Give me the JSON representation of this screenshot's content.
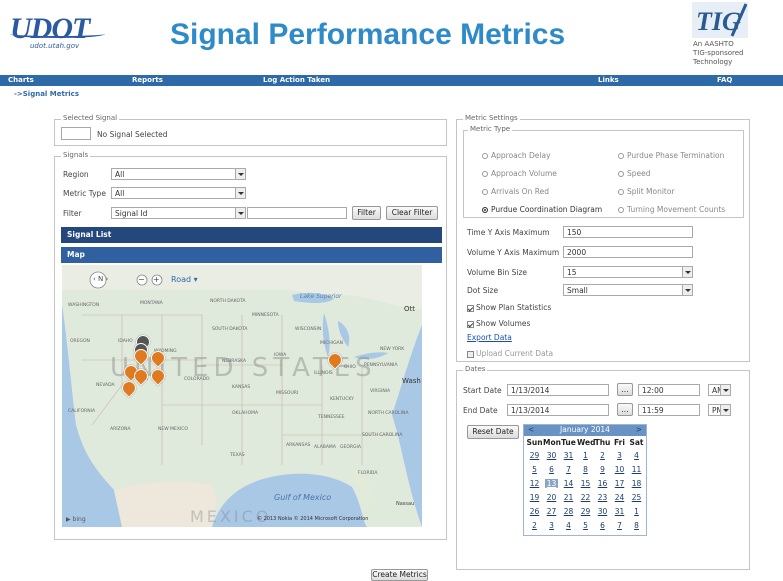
{
  "header": {
    "logo_text": "UDOT",
    "logo_url": "udot.utah.gov",
    "title": "Signal Performance Metrics",
    "tig_logo_text": "TIG",
    "tig_caption": [
      "An AASHTO",
      "TIG-sponsored",
      "Technology"
    ]
  },
  "nav": {
    "items": [
      "Charts",
      "Reports",
      "Log Action Taken",
      "Links",
      "FAQ"
    ]
  },
  "breadcrumb": "->Signal Metrics",
  "selected_signal": {
    "legend": "Selected Signal",
    "value": "",
    "text": "No Signal Selected"
  },
  "signals": {
    "legend": "Signals",
    "region_label": "Region",
    "region_value": "All",
    "metric_type_label": "Metric Type",
    "metric_type_value": "All",
    "filter_label": "Filter",
    "filter_field_value": "Signal Id",
    "filter_text": "",
    "filter_button": "Filter",
    "clear_filter_button": "Clear Filter",
    "signal_list_label": "Signal List",
    "map_label": "Map"
  },
  "map": {
    "road_label": "Road",
    "country_label": "UNITED STATES",
    "gulf_label": "Gulf of Mexico",
    "copyright": "© 2013 Nokia  © 2014 Microsoft Corporation",
    "bing": "bing",
    "labels": [
      "Lake Superior",
      "WASHINGTON",
      "MONTANA",
      "NORTH DAKOTA",
      "MINNESOTA",
      "OREGON",
      "IDAHO",
      "SOUTH DAKOTA",
      "WISCONSIN",
      "WYOMING",
      "NEBRASKA",
      "IOWA",
      "MICHIGAN",
      "NEW YORK",
      "NEVADA",
      "UTAH",
      "COLORADO",
      "KANSAS",
      "MISSOURI",
      "ILLINOIS",
      "OHIO",
      "PENNSYLVANIA",
      "CALIFORNIA",
      "ARIZONA",
      "NEW MEXICO",
      "OKLAHOMA",
      "TENNESSEE",
      "NORTH CAROLINA",
      "TEXAS",
      "ARKANSAS",
      "ALABAMA",
      "GEORGIA",
      "SOUTH CAROLINA",
      "KENTUCKY",
      "VIRGINIA",
      "FLORIDA",
      "Nassau",
      "Ott",
      "Wash",
      "MEXICO"
    ]
  },
  "metric_settings": {
    "legend": "Metric Settings",
    "metric_type_legend": "Metric Type",
    "options_left": [
      "Approach Delay",
      "Approach Volume",
      "Arrivals On Red",
      "Purdue Coordination Diagram"
    ],
    "options_right": [
      "Purdue Phase Termination",
      "Speed",
      "Split Monitor",
      "Turning Movement Counts"
    ],
    "selected": "Purdue Coordination Diagram",
    "time_y_label": "Time Y Axis Maximum",
    "time_y_value": "150",
    "volume_y_label": "Volume Y Axis Maximum",
    "volume_y_value": "2000",
    "volume_bin_label": "Volume Bin Size",
    "volume_bin_value": "15",
    "dot_size_label": "Dot Size",
    "dot_size_value": "Small",
    "show_plan_statistics": "Show Plan Statistics",
    "show_volumes": "Show Volumes",
    "export_data": "Export Data",
    "upload_current_data": "Upload Current Data",
    "show_plan_checked": true,
    "show_volumes_checked": true,
    "upload_checked": false
  },
  "dates": {
    "legend": "Dates",
    "start_label": "Start Date",
    "start_date": "1/13/2014",
    "start_time": "12:00",
    "start_ampm": "AM",
    "end_label": "End Date",
    "end_date": "1/13/2014",
    "end_time": "11:59",
    "end_ampm": "PM",
    "reset_button": "Reset Date",
    "calendar": {
      "prev": "<",
      "next": ">",
      "month": "January 2014",
      "dow": [
        "Sun",
        "Mon",
        "Tue",
        "Wed",
        "Thu",
        "Fri",
        "Sat"
      ],
      "weeks": [
        [
          "29",
          "30",
          "31",
          "1",
          "2",
          "3",
          "4"
        ],
        [
          "5",
          "6",
          "7",
          "8",
          "9",
          "10",
          "11"
        ],
        [
          "12",
          "13",
          "14",
          "15",
          "16",
          "17",
          "18"
        ],
        [
          "19",
          "20",
          "21",
          "22",
          "23",
          "24",
          "25"
        ],
        [
          "26",
          "27",
          "28",
          "29",
          "30",
          "31",
          "1"
        ],
        [
          "2",
          "3",
          "4",
          "5",
          "6",
          "7",
          "8"
        ]
      ],
      "selected_day": "13"
    }
  },
  "create_metrics_button": "Create Metrics",
  "colors": {
    "title_blue": "#2e8bc7",
    "nav_blue": "#2e6aa8",
    "bar_dark": "#24487c",
    "pin_orange": "#e07a1e"
  }
}
